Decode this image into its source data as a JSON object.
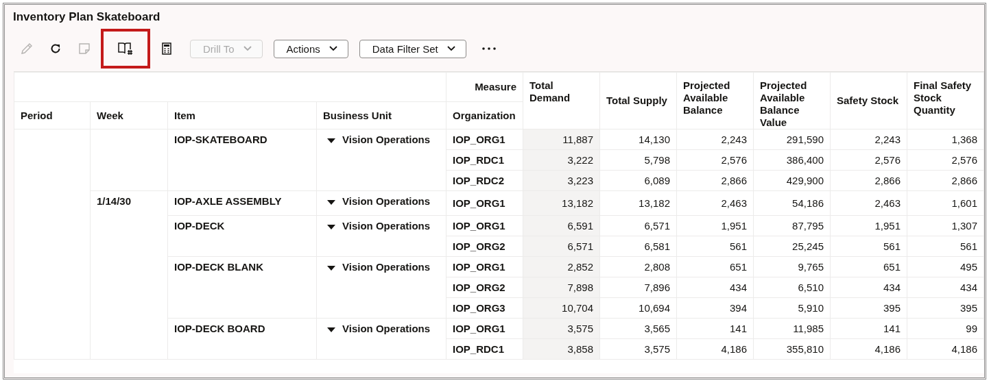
{
  "window": {
    "title": "Inventory Plan Skateboard"
  },
  "toolbar": {
    "icons": [
      {
        "kind": "edit",
        "disabled": true,
        "highlighted": false
      },
      {
        "kind": "refresh",
        "disabled": false,
        "highlighted": false
      },
      {
        "kind": "note",
        "disabled": true,
        "highlighted": false
      },
      {
        "kind": "book",
        "disabled": false,
        "highlighted": true
      },
      {
        "kind": "calculator",
        "disabled": false,
        "highlighted": false
      }
    ],
    "buttons": [
      {
        "label": "Drill To",
        "disabled": true
      },
      {
        "label": "Actions",
        "disabled": false
      },
      {
        "label": "Data Filter Set",
        "disabled": false
      }
    ]
  },
  "table": {
    "measure_label": "Measure",
    "columns": [
      "Period",
      "Week",
      "Item",
      "Business Unit",
      "Organization"
    ],
    "measures": [
      "Total Demand",
      "Total Supply",
      "Projected Available Balance",
      "Projected Available Balance Value",
      "Safety Stock",
      "Final Safety Stock Quantity"
    ],
    "weeks": [
      {
        "items": [
          {
            "item": "IOP-SKATEBOARD",
            "business_unit": "Vision Operations",
            "rows": [
              {
                "org": "IOP_ORG1",
                "values": [
                  "11,887",
                  "14,130",
                  "2,243",
                  "291,590",
                  "2,243",
                  "1,368"
                ]
              },
              {
                "org": "IOP_RDC1",
                "values": [
                  "3,222",
                  "5,798",
                  "2,576",
                  "386,400",
                  "2,576",
                  "2,576"
                ]
              },
              {
                "org": "IOP_RDC2",
                "values": [
                  "3,223",
                  "6,089",
                  "2,866",
                  "429,900",
                  "2,866",
                  "2,866"
                ]
              }
            ]
          }
        ]
      },
      {
        "week": "1/14/30",
        "items": [
          {
            "item": "IOP-AXLE ASSEMBLY",
            "business_unit": "Vision Operations",
            "rows": [
              {
                "org": "IOP_ORG1",
                "values": [
                  "13,182",
                  "13,182",
                  "2,463",
                  "54,186",
                  "2,463",
                  "1,601"
                ]
              }
            ]
          },
          {
            "item": "IOP-DECK",
            "business_unit": "Vision Operations",
            "rows": [
              {
                "org": "IOP_ORG1",
                "values": [
                  "6,591",
                  "6,571",
                  "1,951",
                  "87,795",
                  "1,951",
                  "1,307"
                ]
              },
              {
                "org": "IOP_ORG2",
                "values": [
                  "6,571",
                  "6,581",
                  "561",
                  "25,245",
                  "561",
                  "561"
                ]
              }
            ]
          },
          {
            "item": "IOP-DECK BLANK",
            "business_unit": "Vision Operations",
            "rows": [
              {
                "org": "IOP_ORG1",
                "values": [
                  "2,852",
                  "2,808",
                  "651",
                  "9,765",
                  "651",
                  "495"
                ]
              },
              {
                "org": "IOP_ORG2",
                "values": [
                  "7,898",
                  "7,896",
                  "434",
                  "6,510",
                  "434",
                  "434"
                ]
              },
              {
                "org": "IOP_ORG3",
                "values": [
                  "10,704",
                  "10,694",
                  "394",
                  "5,910",
                  "395",
                  "395"
                ]
              }
            ]
          },
          {
            "item": "IOP-DECK BOARD",
            "business_unit": "Vision Operations",
            "rows": [
              {
                "org": "IOP_ORG1",
                "values": [
                  "3,575",
                  "3,565",
                  "141",
                  "11,985",
                  "141",
                  "99"
                ]
              },
              {
                "org": "IOP_RDC1",
                "values": [
                  "3,858",
                  "3,575",
                  "4,186",
                  "355,810",
                  "4,186",
                  "4,186"
                ]
              }
            ]
          }
        ]
      }
    ]
  }
}
